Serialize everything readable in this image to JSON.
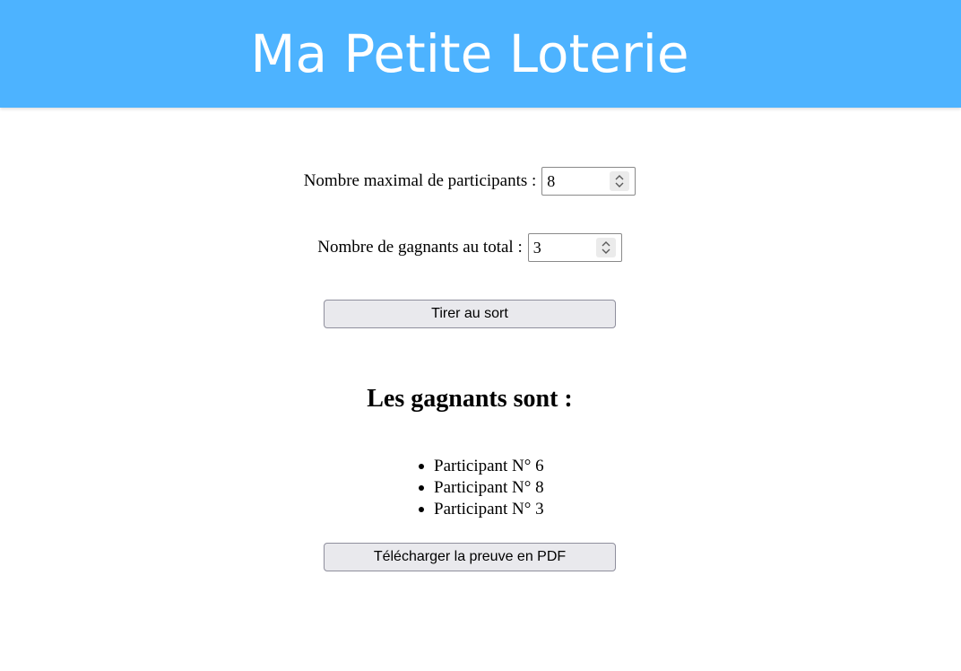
{
  "header": {
    "title": "Ma Petite Loterie",
    "background_color": "#4db3ff"
  },
  "form": {
    "max_participants_label": "Nombre maximal de participants :",
    "max_participants_value": "8",
    "total_winners_label": "Nombre de gagnants au total :",
    "total_winners_value": "3",
    "draw_button_label": "Tirer au sort"
  },
  "results": {
    "title": "Les gagnants sont :",
    "winners": [
      "Participant N° 6",
      "Participant N° 8",
      "Participant N° 3"
    ],
    "pdf_button_label": "Télécharger la preuve en PDF"
  },
  "icons": {
    "spinner": "spinner-arrows-icon"
  }
}
